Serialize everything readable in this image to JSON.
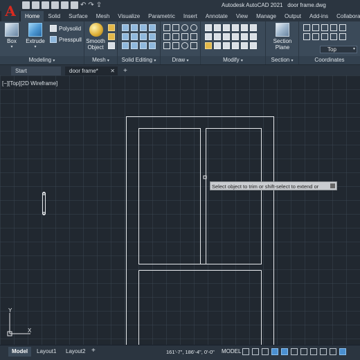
{
  "app": {
    "logo": "A",
    "title": "Autodesk AutoCAD 2021",
    "filename": "door frame.dwg"
  },
  "ribbon_tabs": [
    "Home",
    "Solid",
    "Surface",
    "Mesh",
    "Visualize",
    "Parametric",
    "Insert",
    "Annotate",
    "View",
    "Manage",
    "Output",
    "Add-ins",
    "Collaborate"
  ],
  "ribbon": {
    "modeling": {
      "label": "Modeling",
      "box": "Box",
      "extrude": "Extrude",
      "polysolid": "Polysolid",
      "presspull": "Presspull"
    },
    "mesh": {
      "label": "Mesh",
      "smooth_object": "Smooth Object"
    },
    "solid_editing": {
      "label": "Solid Editing"
    },
    "draw": {
      "label": "Draw"
    },
    "modify": {
      "label": "Modify"
    },
    "section": {
      "label": "Section",
      "section_plane": "Section Plane"
    },
    "coordinates": {
      "label": "Coordinates",
      "view_select": "Top"
    }
  },
  "document_tabs": {
    "start": "Start",
    "active": "door frame*",
    "close": "✕",
    "add": "+"
  },
  "viewport": {
    "label": "[−][Top][2D Wireframe]"
  },
  "command_tooltip": "Select object to trim or shift-select to extend or",
  "ucs": {
    "x": "X",
    "y": "Y"
  },
  "status_bar": {
    "layout_tabs": [
      "Model",
      "Layout1",
      "Layout2"
    ],
    "add": "+",
    "coordinates": "161'-7\", 186'-4\", 0'-0\"",
    "model_button": "MODEL"
  },
  "colors": {
    "background": "#212830",
    "ribbon": "#3b4a59",
    "logo": "#d82a20",
    "lines": "#e6e9ec"
  }
}
